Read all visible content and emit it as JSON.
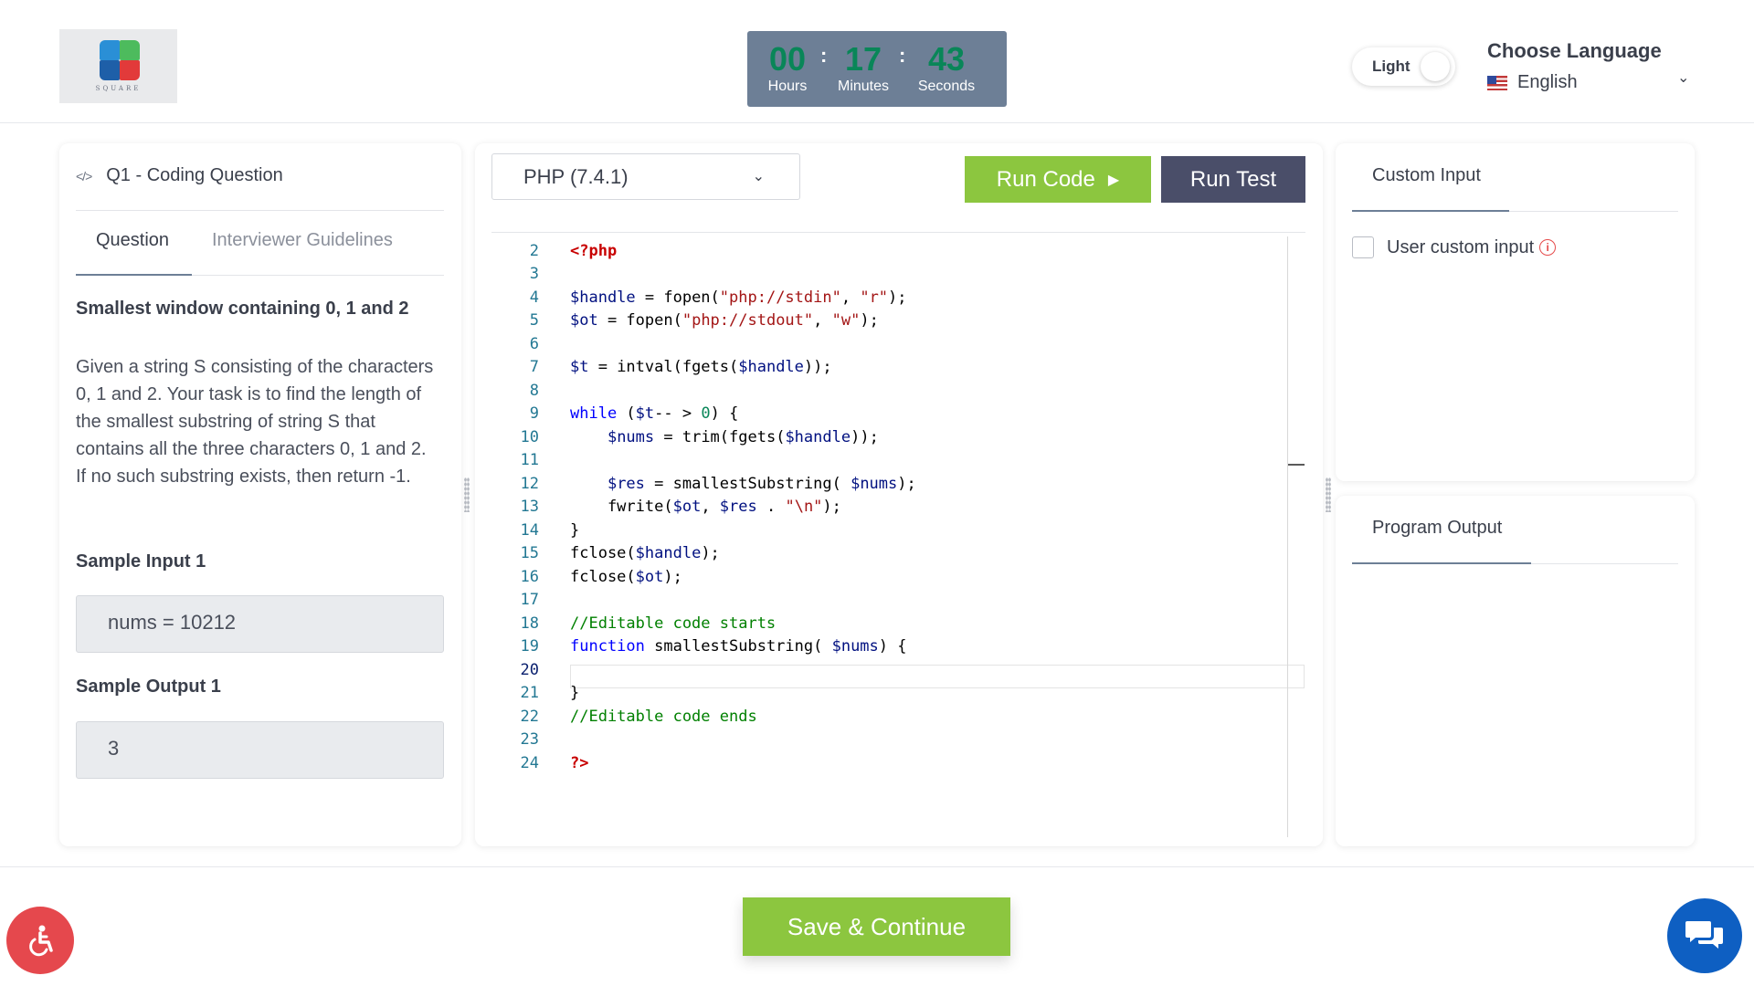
{
  "header": {
    "logo_text": "SQUARE",
    "timer": {
      "hours": "00",
      "minutes": "17",
      "seconds": "43",
      "hours_label": "Hours",
      "minutes_label": "Minutes",
      "seconds_label": "Seconds",
      "separator": ":"
    },
    "theme_toggle": {
      "label": "Light"
    },
    "language": {
      "title": "Choose Language",
      "current": "English",
      "flag": "us-flag-icon"
    }
  },
  "question_panel": {
    "heading": "Q1 - Coding Question",
    "heading_icon": "code-icon",
    "tabs": [
      {
        "label": "Question",
        "active": true
      },
      {
        "label": "Interviewer Guidelines",
        "active": false
      }
    ],
    "title": "Smallest window containing 0, 1 and 2",
    "body": "Given a string S consisting of the characters 0, 1 and 2. Your task is to find the length of the smallest substring of string S that contains all the three characters 0, 1 and 2. If no such substring exists, then return -1.",
    "sample_input_label": "Sample Input 1",
    "sample_input_value": "nums = 10212",
    "sample_output_label": "Sample Output 1",
    "sample_output_value": "3"
  },
  "editor": {
    "language_select": "PHP (7.4.1)",
    "run_code_label": "Run Code",
    "run_test_label": "Run Test",
    "current_line": 20,
    "line_numbers": [
      "2",
      "3",
      "4",
      "5",
      "6",
      "7",
      "8",
      "9",
      "10",
      "11",
      "12",
      "13",
      "14",
      "15",
      "16",
      "17",
      "18",
      "19",
      "20",
      "21",
      "22",
      "23",
      "24"
    ]
  },
  "right_panel": {
    "custom_input_tab": "Custom Input",
    "custom_input_checkbox_label": "User custom input",
    "custom_input_checked": false,
    "program_output_tab": "Program Output"
  },
  "footer": {
    "save_label": "Save & Continue",
    "accessibility_icon": "accessibility-icon",
    "chat_icon": "chat-icon"
  },
  "colors": {
    "accent_green": "#8cc63f",
    "timer_bg": "#6d7f96",
    "run_test_bg": "#4a4e69",
    "a11y_red": "#e5484d",
    "chat_blue": "#0e5fc2"
  }
}
